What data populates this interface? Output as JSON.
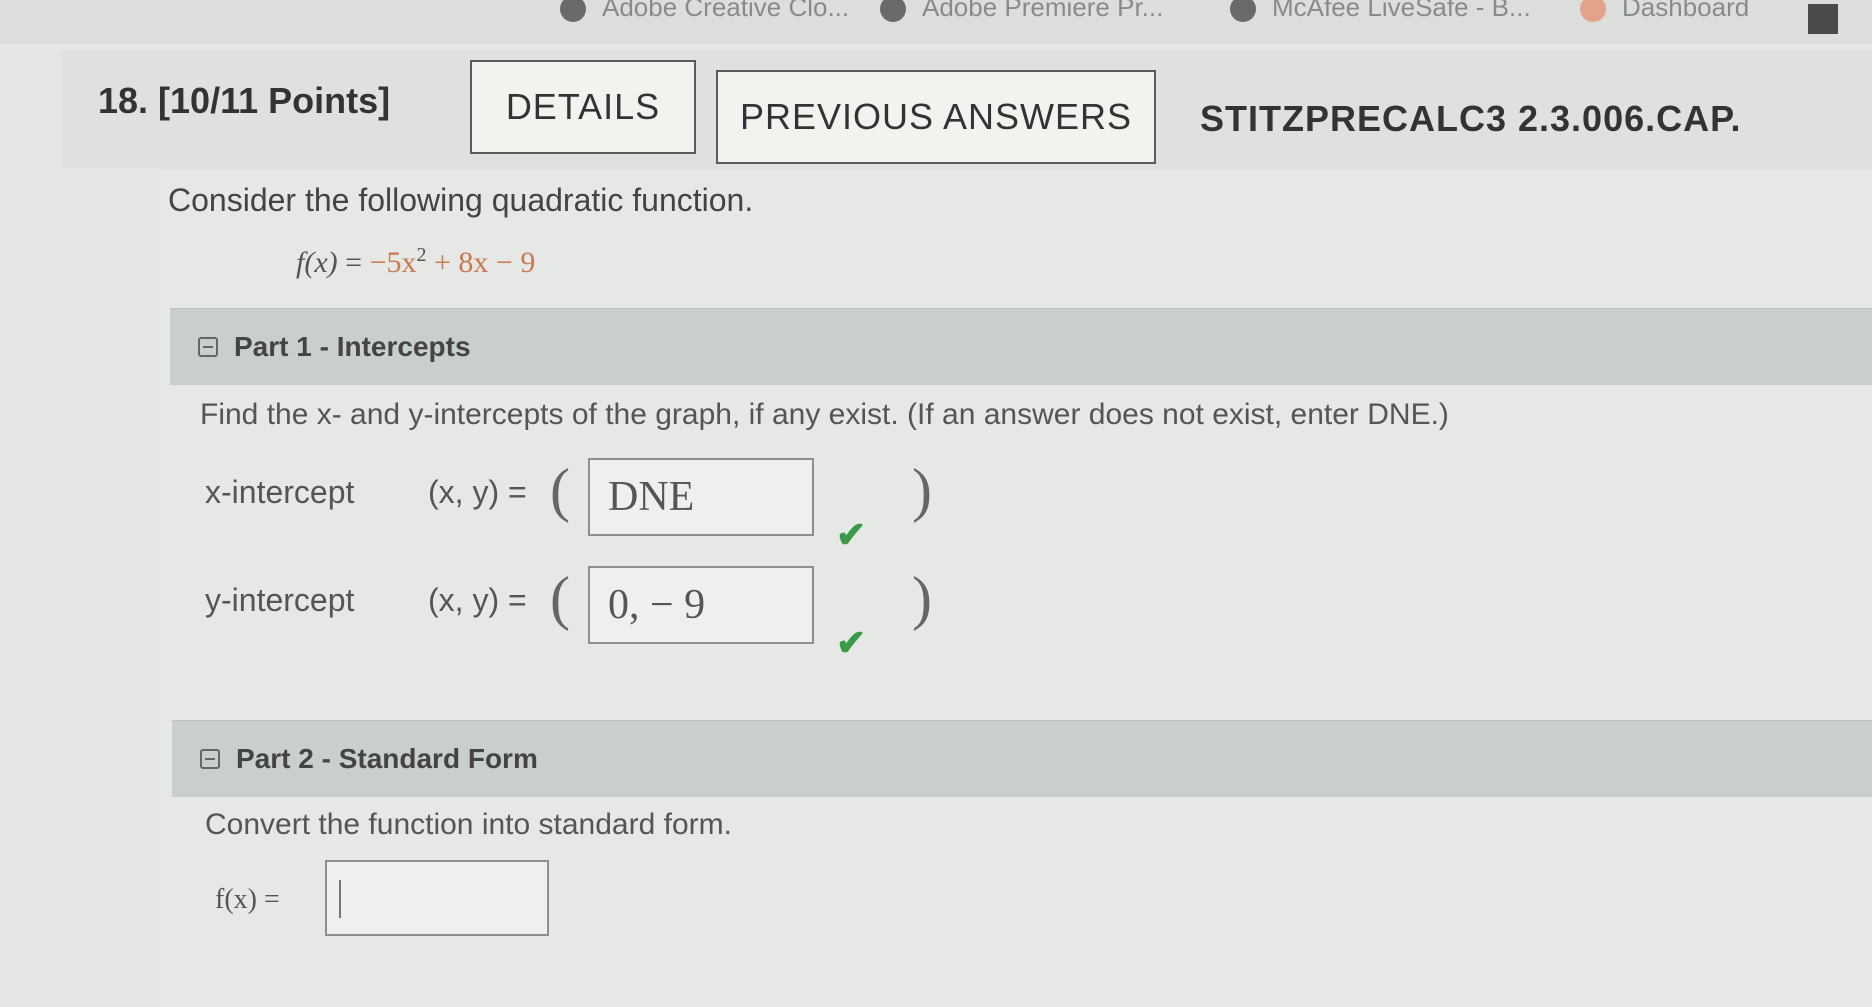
{
  "browser": {
    "bookmarks": [
      {
        "label": "Adobe Creative Clo..."
      },
      {
        "label": "Adobe Premiere Pr..."
      },
      {
        "label": "McAfee LiveSafe - B..."
      },
      {
        "label": "Dashboard"
      }
    ]
  },
  "question": {
    "number_points": "18. [10/11 Points]",
    "details_label": "DETAILS",
    "previous_answers_label": "PREVIOUS ANSWERS",
    "course_code": "STITZPRECALC3 2.3.006.CAP.",
    "intro": "Consider the following quadratic function.",
    "function_lhs": "f(x)",
    "function_eq": " = ",
    "function_part1": "−5x",
    "function_exp": "2",
    "function_part2": " + 8x − 9"
  },
  "part1": {
    "title": "Part 1 - Intercepts",
    "instruction": "Find the x- and y-intercepts of the graph, if any exist. (If an answer does not exist, enter DNE.)",
    "x_label": "x-intercept",
    "x_xy": "(x, y) =",
    "x_value": "DNE",
    "y_label": "y-intercept",
    "y_xy": "(x, y) =",
    "y_value": "0, − 9",
    "open_paren": "(",
    "close_paren": ")",
    "check_glyph": "✔"
  },
  "part2": {
    "title": "Part 2 - Standard Form",
    "instruction": "Convert the function into standard form.",
    "f_label": "f(x)  =",
    "input_value": ""
  }
}
